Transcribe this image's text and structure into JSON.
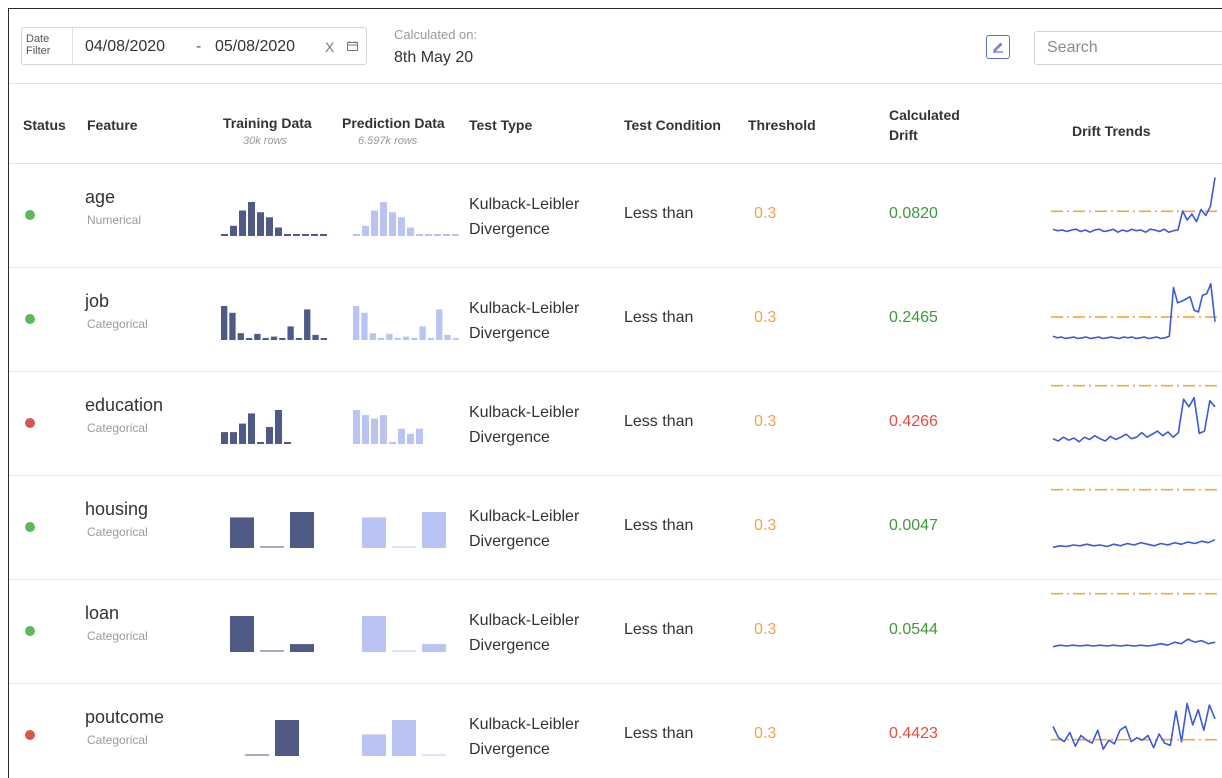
{
  "toolbar": {
    "date_filter_label": "Date Filter",
    "date_start": "04/08/2020",
    "date_separator": "-",
    "date_end": "05/08/2020",
    "clear_icon": "X",
    "calendar_icon": "calendar-icon",
    "calculated_label": "Calculated on:",
    "calculated_value": "8th May 20",
    "edit_icon": "pencil-icon",
    "search_placeholder": "Search"
  },
  "table": {
    "headers": {
      "status": "Status",
      "feature": "Feature",
      "training_data": "Training Data",
      "training_rows": "30k rows",
      "prediction_data": "Prediction Data",
      "prediction_rows": "6.597k rows",
      "test_type": "Test Type",
      "test_condition": "Test Condition",
      "threshold": "Threshold",
      "calculated_drift": "Calculated Drift",
      "drift_trends": "Drift Trends"
    },
    "rows": [
      {
        "feature": "age",
        "type": "Numerical",
        "status": "ok",
        "test_type_1": "Kulback-Leibler",
        "test_type_2": "Divergence",
        "condition": "Less than",
        "threshold": "0.3",
        "drift": "0.0820",
        "train_hist": [
          0.04,
          0.3,
          0.75,
          1.0,
          0.7,
          0.55,
          0.25,
          0.04,
          0.03,
          0.02,
          0.02,
          0.01
        ],
        "pred_hist": [
          0.04,
          0.3,
          0.75,
          1.0,
          0.7,
          0.55,
          0.25,
          0.04,
          0.03,
          0.02,
          0.02,
          0.01
        ],
        "trend": [
          0.7,
          0.72,
          0.71,
          0.73,
          0.71,
          0.7,
          0.73,
          0.71,
          0.74,
          0.71,
          0.7,
          0.73,
          0.72,
          0.7,
          0.74,
          0.71,
          0.73,
          0.7,
          0.72,
          0.71,
          0.74,
          0.7,
          0.71,
          0.73,
          0.7,
          0.74,
          0.72,
          0.71,
          0.46,
          0.58,
          0.5,
          0.6,
          0.44,
          0.52,
          0.4,
          0.02
        ],
        "threshold_level": 0.42
      },
      {
        "feature": "job",
        "type": "Categorical",
        "status": "ok",
        "test_type_1": "Kulback-Leibler",
        "test_type_2": "Divergence",
        "condition": "Less than",
        "threshold": "0.3",
        "drift": "0.2465",
        "train_hist": [
          1.0,
          0.8,
          0.2,
          0.04,
          0.18,
          0.04,
          0.1,
          0.04,
          0.4,
          0.04,
          0.9,
          0.15,
          0.04
        ],
        "pred_hist": [
          1.0,
          0.8,
          0.2,
          0.04,
          0.18,
          0.04,
          0.1,
          0.04,
          0.4,
          0.04,
          0.9,
          0.15,
          0.04
        ],
        "trend": [
          0.74,
          0.76,
          0.75,
          0.77,
          0.76,
          0.75,
          0.77,
          0.76,
          0.75,
          0.77,
          0.76,
          0.75,
          0.77,
          0.76,
          0.75,
          0.76,
          0.77,
          0.75,
          0.76,
          0.75,
          0.77,
          0.76,
          0.75,
          0.77,
          0.76,
          0.75,
          0.77,
          0.76,
          0.74,
          0.1,
          0.3,
          0.28,
          0.25,
          0.22,
          0.4,
          0.42,
          0.2,
          0.18,
          0.05,
          0.55
        ],
        "threshold_level": 0.44
      },
      {
        "feature": "education",
        "type": "Categorical",
        "status": "bad",
        "test_type_1": "Kulback-Leibler",
        "test_type_2": "Divergence",
        "condition": "Less than",
        "threshold": "0.3",
        "drift": "0.4266",
        "train_hist": [
          0.35,
          0.35,
          0.6,
          0.9,
          0.04,
          0.5,
          1.0,
          0.04
        ],
        "pred_hist": [
          1.0,
          0.85,
          0.75,
          0.85,
          0.04,
          0.45,
          0.3,
          0.45
        ],
        "trend": [
          0.72,
          0.75,
          0.7,
          0.74,
          0.71,
          0.76,
          0.7,
          0.73,
          0.68,
          0.72,
          0.75,
          0.69,
          0.73,
          0.7,
          0.66,
          0.72,
          0.7,
          0.64,
          0.7,
          0.66,
          0.62,
          0.68,
          0.63,
          0.7,
          0.64,
          0.2,
          0.3,
          0.18,
          0.65,
          0.62,
          0.22,
          0.3
        ],
        "threshold_level": 0.02
      },
      {
        "feature": "housing",
        "type": "Categorical",
        "status": "ok",
        "test_type_1": "Kulback-Leibler",
        "test_type_2": "Divergence",
        "condition": "Less than",
        "threshold": "0.3",
        "drift": "0.0047",
        "train_hist": [
          0.85,
          0.0,
          1.0
        ],
        "pred_hist": [
          0.85,
          0.0,
          1.0
        ],
        "trend": [
          0.78,
          0.76,
          0.77,
          0.75,
          0.76,
          0.74,
          0.76,
          0.75,
          0.77,
          0.74,
          0.76,
          0.73,
          0.75,
          0.72,
          0.74,
          0.76,
          0.73,
          0.75,
          0.72,
          0.74,
          0.71,
          0.73,
          0.7,
          0.72,
          0.68
        ],
        "threshold_level": 0.02
      },
      {
        "feature": "loan",
        "type": "Categorical",
        "status": "ok",
        "test_type_1": "Kulback-Leibler",
        "test_type_2": "Divergence",
        "condition": "Less than",
        "threshold": "0.3",
        "drift": "0.0544",
        "train_hist": [
          1.0,
          0.0,
          0.22
        ],
        "pred_hist": [
          1.0,
          0.0,
          0.22
        ],
        "trend": [
          0.72,
          0.7,
          0.71,
          0.7,
          0.71,
          0.7,
          0.71,
          0.7,
          0.71,
          0.7,
          0.71,
          0.7,
          0.71,
          0.7,
          0.71,
          0.7,
          0.68,
          0.7,
          0.66,
          0.68,
          0.62,
          0.66,
          0.64,
          0.68,
          0.66
        ],
        "threshold_level": 0.02
      },
      {
        "feature": "poutcome",
        "type": "Categorical",
        "status": "bad",
        "test_type_1": "Kulback-Leibler",
        "test_type_2": "Divergence",
        "condition": "Less than",
        "threshold": "0.3",
        "drift": "0.4423",
        "train_hist": [
          0.0,
          1.0
        ],
        "pred_hist": [
          0.6,
          1.0,
          0.0
        ],
        "trend": [
          0.4,
          0.55,
          0.6,
          0.48,
          0.66,
          0.52,
          0.58,
          0.62,
          0.45,
          0.7,
          0.58,
          0.63,
          0.45,
          0.4,
          0.6,
          0.55,
          0.58,
          0.52,
          0.68,
          0.5,
          0.62,
          0.65,
          0.2,
          0.6,
          0.1,
          0.38,
          0.18,
          0.45,
          0.12,
          0.3
        ],
        "threshold_level": 0.52
      }
    ]
  },
  "colors": {
    "status_ok": "#5cb85c",
    "status_bad": "#d9534f",
    "drift_ok": "#3c9a3c",
    "drift_bad": "#e74c3c",
    "threshold": "#f0a544",
    "train_bar": "#4f5a86",
    "pred_bar": "#b9c4f5",
    "trend_line": "#3a5ad6",
    "trend_threshold": "#f0a544",
    "accent": "#5b6fd6"
  }
}
